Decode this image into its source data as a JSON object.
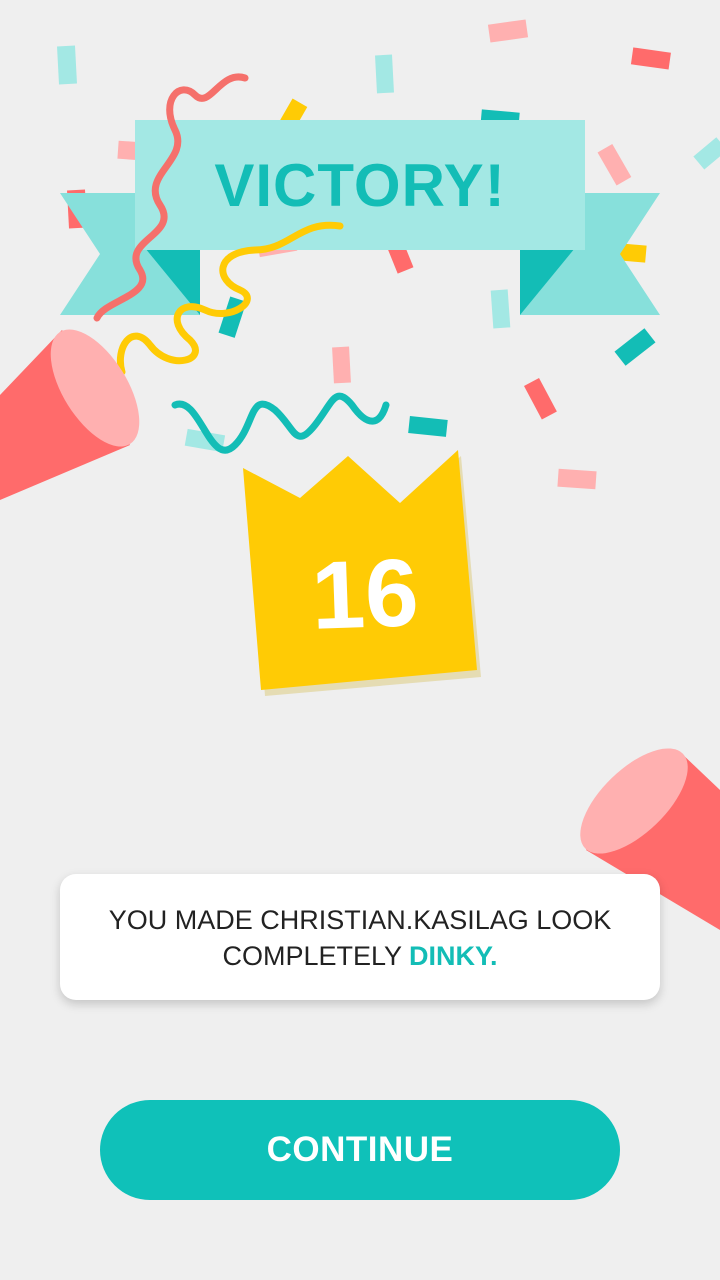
{
  "banner": {
    "title": "VICTORY!"
  },
  "score": {
    "value": "16"
  },
  "message": {
    "prefix": "YOU MADE CHRISTIAN.KASILAG LOOK COMPLETELY ",
    "highlight": "DINKY."
  },
  "actions": {
    "continue_label": "CONTINUE"
  },
  "colors": {
    "background": "#efefef",
    "teal": "#13bdb6",
    "ribbon_light": "#a3e8e4",
    "crown_yellow": "#ffcb05",
    "popper_red": "#ff6b6b",
    "popper_pink": "#ffb0b0"
  }
}
